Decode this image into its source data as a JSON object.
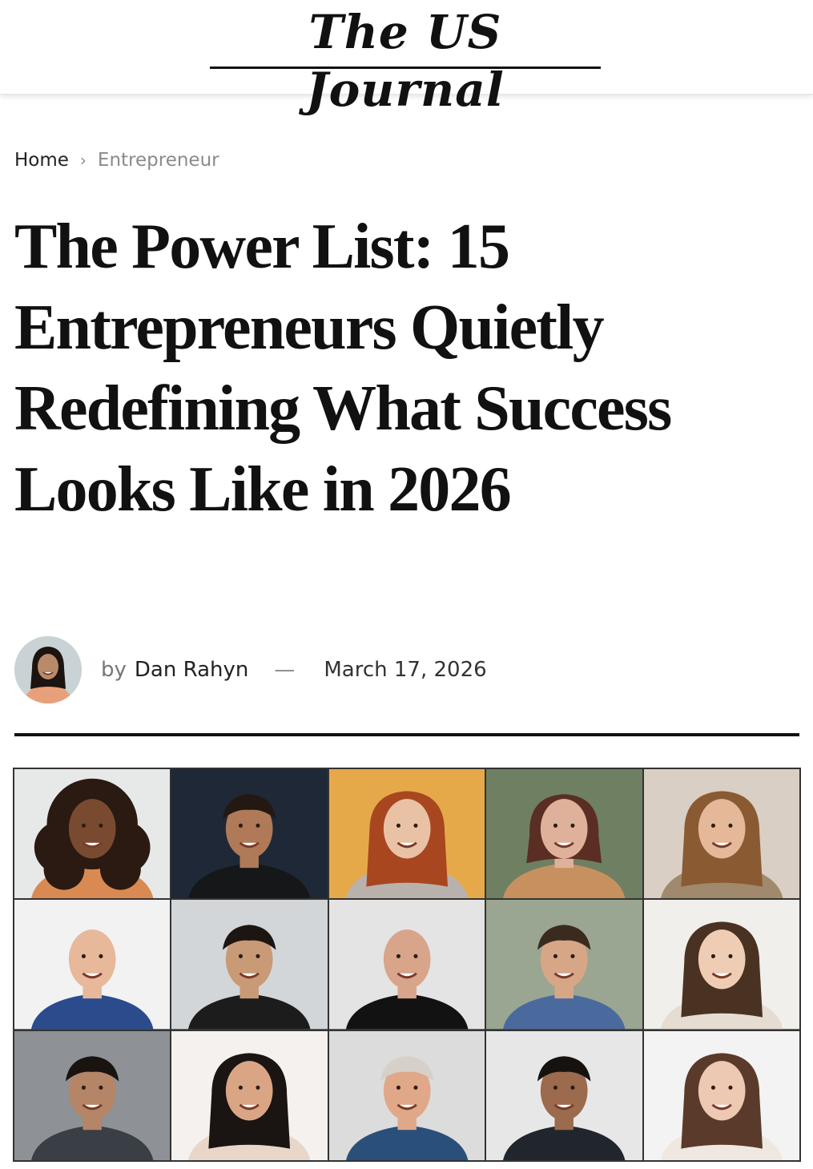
{
  "site": {
    "logo_text": "The US Journal"
  },
  "breadcrumb": {
    "home": "Home",
    "separator": "›",
    "current": "Entrepreneur"
  },
  "article": {
    "title": "The Power List: 15 Entrepreneurs Quietly Redefining What Success Looks Like in 2026",
    "by_prefix": "by",
    "author": "Dan Rahyn",
    "separator": "—",
    "date": "March 17, 2026"
  },
  "photo_grid": {
    "portraits": [
      {
        "bg": "#e7e9e8",
        "skin": "#7a4a30",
        "hair": "#2b1a12",
        "shirt": "#d98a52",
        "hair_style": "curly"
      },
      {
        "bg": "#1e2836",
        "skin": "#b07a58",
        "hair": "#231812",
        "shirt": "#151719",
        "hair_style": "short"
      },
      {
        "bg": "#e6a94a",
        "skin": "#e9c2a6",
        "hair": "#a8471f",
        "shirt": "#b9b2ac",
        "hair_style": "long"
      },
      {
        "bg": "#6f7f62",
        "skin": "#e0b19a",
        "hair": "#5a2e22",
        "shirt": "#c7915f",
        "hair_style": "bob"
      },
      {
        "bg": "#d9cfc4",
        "skin": "#e4b898",
        "hair": "#8a5a32",
        "shirt": "#a0896c",
        "hair_style": "long"
      },
      {
        "bg": "#f2f2f2",
        "skin": "#e7b89a",
        "hair": "#e7b89a",
        "shirt": "#2b4b8c",
        "hair_style": "bald"
      },
      {
        "bg": "#d3d6d8",
        "skin": "#c99a76",
        "hair": "#1c1512",
        "shirt": "#1c1c1c",
        "hair_style": "short"
      },
      {
        "bg": "#e4e4e4",
        "skin": "#d8a48a",
        "hair": "#d8a48a",
        "shirt": "#121212",
        "hair_style": "bald"
      },
      {
        "bg": "#9aa592",
        "skin": "#d7a687",
        "hair": "#3b2a1e",
        "shirt": "#4a6a9e",
        "hair_style": "short"
      },
      {
        "bg": "#f1efec",
        "skin": "#efcdb4",
        "hair": "#4a3222",
        "shirt": "#e6ddd2",
        "hair_style": "long"
      },
      {
        "bg": "#8e9296",
        "skin": "#b48566",
        "hair": "#1a1410",
        "shirt": "#3a3f46",
        "hair_style": "short"
      },
      {
        "bg": "#f4f1ee",
        "skin": "#d9a585",
        "hair": "#1a1412",
        "shirt": "#e8d6c8",
        "hair_style": "long"
      },
      {
        "bg": "#dcdcdc",
        "skin": "#e0a888",
        "hair": "#d6d0c8",
        "shirt": "#2a4f7a",
        "hair_style": "short"
      },
      {
        "bg": "#e7e7e7",
        "skin": "#9c6a4c",
        "hair": "#161210",
        "shirt": "#20262c",
        "hair_style": "short"
      },
      {
        "bg": "#f3f3f3",
        "skin": "#edc8b2",
        "hair": "#5a3a2a",
        "shirt": "#efe8e0",
        "hair_style": "long"
      }
    ]
  },
  "author_avatar": {
    "bg": "#c9d3d6",
    "skin": "#b98a6a",
    "hair": "#1c1410",
    "shirt": "#e8a07a"
  }
}
